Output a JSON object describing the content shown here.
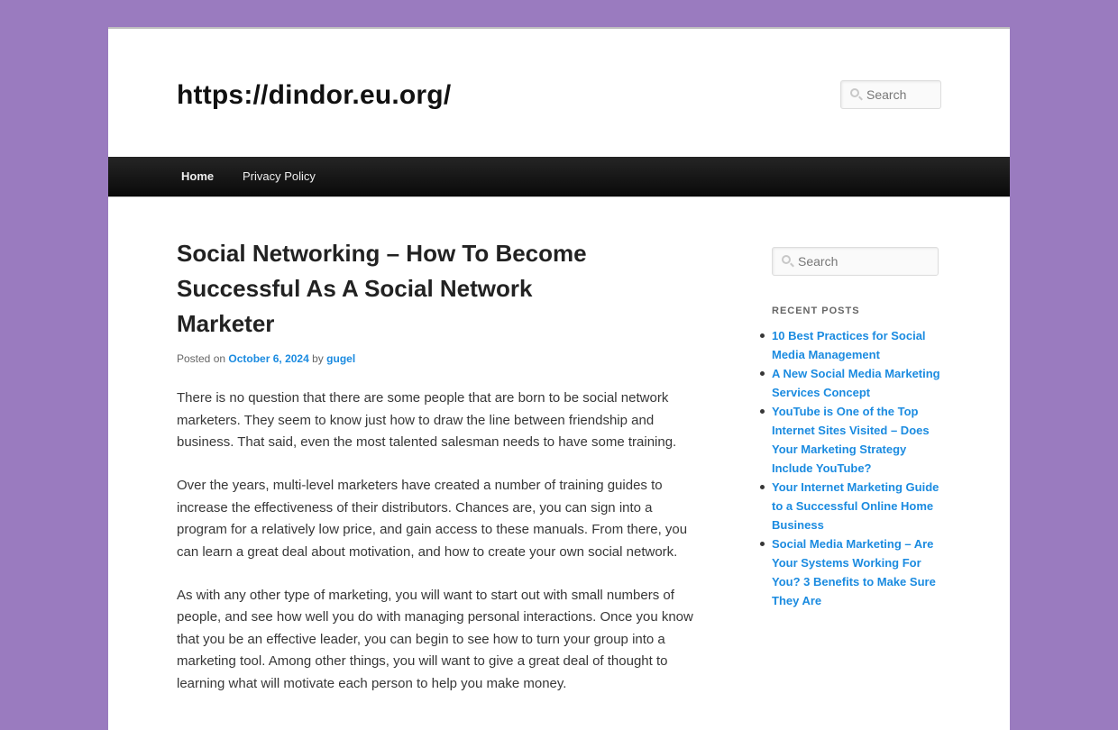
{
  "site": {
    "title": "https://dindor.eu.org/",
    "search_placeholder": "Search"
  },
  "nav": {
    "items": [
      {
        "label": "Home"
      },
      {
        "label": "Privacy Policy"
      }
    ]
  },
  "post": {
    "title": "Social Networking – How To Become Successful As A Social Network Marketer",
    "meta": {
      "posted_on_label": "Posted on",
      "date": "October 6, 2024",
      "by_label": "by",
      "author": "gugel"
    },
    "paragraphs": [
      "There is no question that there are some people that are born to be social network marketers. They seem to know just how to draw the line between friendship and business. That said, even the most talented salesman needs to have some training.",
      "Over the years, multi-level marketers have created a number of training guides to increase the effectiveness of their distributors. Chances are, you can sign into a program for a relatively low price, and gain access to these manuals. From there, you can learn a great deal about motivation, and how to create your own social network.",
      "As with any other type of marketing, you will want to start out with small numbers of people, and see how well you do with managing personal interactions. Once you know that you be an effective leader, you can begin to see how to turn your group into a marketing tool. Among other things, you will want to give a great deal of thought to learning what will motivate each person to help you make money."
    ]
  },
  "sidebar": {
    "search_placeholder": "Search",
    "recent_posts_title": "Recent Posts",
    "recent_posts": [
      {
        "label": "10 Best Practices for Social Media Management"
      },
      {
        "label": "A New Social Media Marketing Services Concept"
      },
      {
        "label": "YouTube is One of the Top Internet Sites Visited – Does Your Marketing Strategy Include YouTube?"
      },
      {
        "label": "Your Internet Marketing Guide to a Successful Online Home Business"
      },
      {
        "label": "Social Media Marketing – Are Your Systems Working For You? 3 Benefits to Make Sure They Are"
      }
    ]
  },
  "colors": {
    "background": "#9a7bbf",
    "link": "#1b8be0",
    "navbar": "#1a1a1a"
  },
  "icons": {
    "search": "search-icon"
  }
}
